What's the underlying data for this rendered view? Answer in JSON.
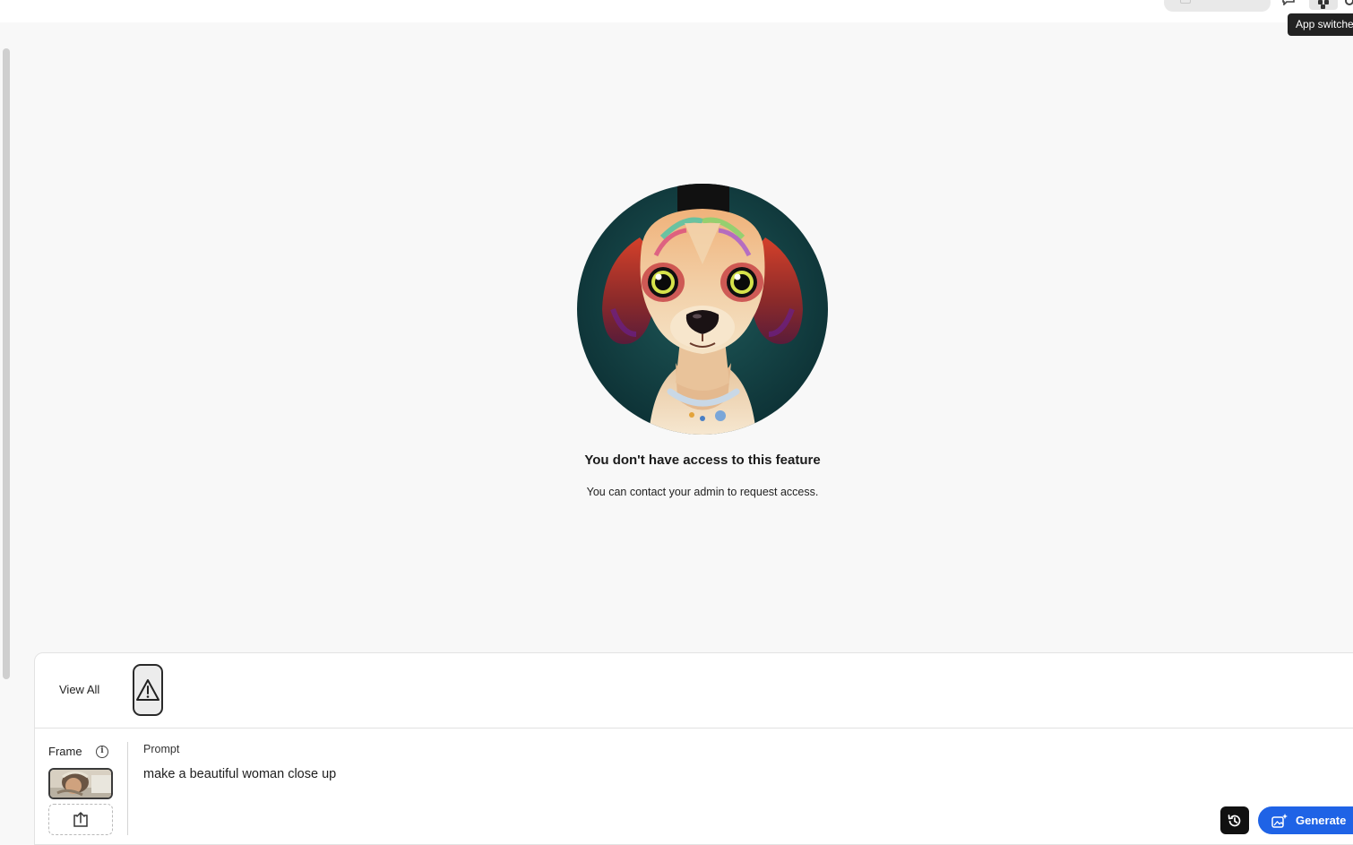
{
  "topbar": {
    "tooltip": "App switcher"
  },
  "main": {
    "title": "You don't have access to this feature",
    "subtitle": "You can contact your admin to request access."
  },
  "panel": {
    "view_all": "View All",
    "frame_label": "Frame",
    "prompt_label": "Prompt",
    "prompt_value": "make a beautiful woman close up",
    "generate_label": "Generate"
  },
  "colors": {
    "accent": "#1f63e6",
    "background": "#f8f8f8"
  },
  "icons": {
    "warning": "warning-icon",
    "info": "info-icon",
    "upload": "upload-icon",
    "history": "history-icon",
    "generate": "sparkle-image-icon",
    "app_switcher": "grid-icon"
  }
}
